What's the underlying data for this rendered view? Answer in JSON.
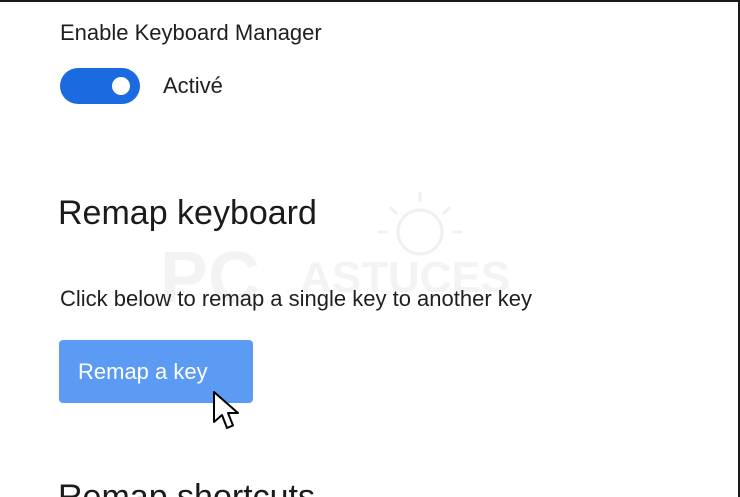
{
  "settings": {
    "enable_label": "Enable Keyboard Manager",
    "toggle_state_text": "Activé",
    "toggle_on": true
  },
  "remap_keyboard": {
    "title": "Remap keyboard",
    "description": "Click below to remap a single key to another key",
    "button_label": "Remap a key"
  },
  "remap_shortcuts": {
    "title": "Remap shortcuts"
  },
  "watermark": {
    "text_main": "PC",
    "text_sub": "ASTUCES"
  },
  "colors": {
    "toggle_on": "#1a6ae0",
    "button_bg": "#5c9bf4",
    "button_text": "#ffffff",
    "text": "#1b1b1b"
  },
  "icons": {
    "pointer": "mouse-pointer-icon",
    "watermark": "watermark-logo-icon"
  }
}
